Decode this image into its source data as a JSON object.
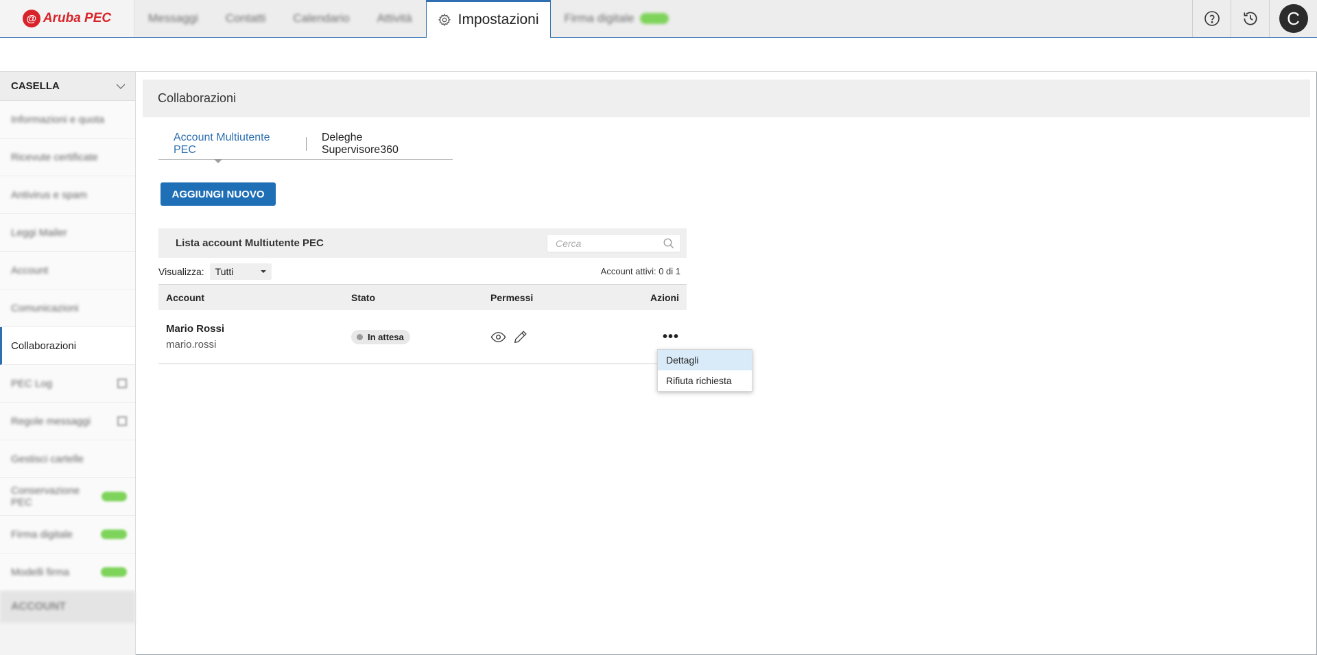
{
  "brand": {
    "name": "Aruba PEC",
    "mark": "@"
  },
  "topnav": {
    "items": [
      "Messaggi",
      "Contatti",
      "Calendario",
      "Attività"
    ],
    "active": "Impostazioni",
    "after": "Firma digitale"
  },
  "user": {
    "initial": "C"
  },
  "sidebar": {
    "header": "CASELLA",
    "items": [
      {
        "label": "Informazioni e quota",
        "active": false
      },
      {
        "label": "Ricevute certificate",
        "active": false
      },
      {
        "label": "Antivirus e spam",
        "active": false
      },
      {
        "label": "Leggi Mailer",
        "active": false
      },
      {
        "label": "Account",
        "active": false
      },
      {
        "label": "Comunicazioni",
        "active": false
      },
      {
        "label": "Collaborazioni",
        "active": true
      },
      {
        "label": "PEC Log",
        "active": false
      },
      {
        "label": "Regole messaggi",
        "active": false
      },
      {
        "label": "Gestisci cartelle",
        "active": false
      },
      {
        "label": "Conservazione PEC",
        "active": false
      },
      {
        "label": "Firma digitale",
        "active": false
      },
      {
        "label": "Modelli firma",
        "active": false
      }
    ],
    "footer": "ACCOUNT"
  },
  "page": {
    "title": "Collaborazioni"
  },
  "tabs": [
    {
      "label": "Account Multiutente PEC",
      "active": true
    },
    {
      "label": "Deleghe Supervisore360",
      "active": false
    }
  ],
  "actions": {
    "add_label": "AGGIUNGI NUOVO"
  },
  "list": {
    "title": "Lista account Multiutente PEC",
    "search_placeholder": "Cerca",
    "filter_label": "Visualizza:",
    "filter_value": "Tutti",
    "count": "Account attivi: 0 di 1"
  },
  "table": {
    "headers": [
      "Account",
      "Stato",
      "Permessi",
      "Azioni"
    ],
    "rows": [
      {
        "name": "Mario Rossi",
        "username": "mario.rossi",
        "status": "In attesa",
        "actions": "•••"
      }
    ]
  },
  "context_menu": {
    "items": [
      "Dettagli",
      "Rifiuta richiesta"
    ]
  },
  "colors": {
    "accent": "#1f6fb7",
    "brand": "#d8232a",
    "highlight": "#d9ebf9"
  }
}
